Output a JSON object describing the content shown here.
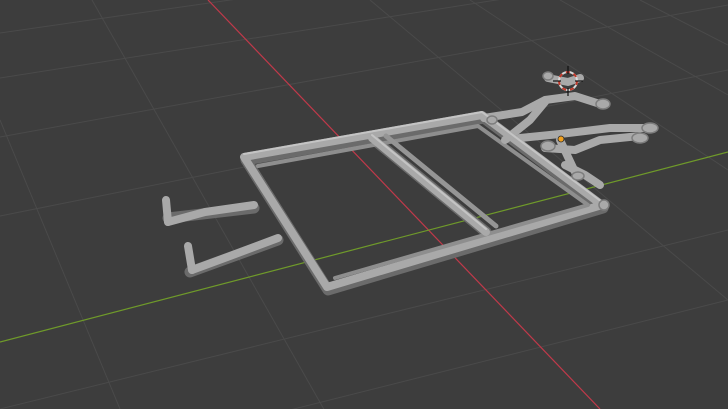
{
  "viewport": {
    "mode": "3d-viewport-solid-shading",
    "background_color": "#3d3d3d",
    "grid_color": "#4a4a4a",
    "x_axis_color": "#c0394a",
    "y_axis_color": "#6f9a2a",
    "mesh_color": "#a9a9a9",
    "mesh_shadow_color": "#6b6b6b",
    "origin_point_color": "#f0a020",
    "cursor_ring_color_a": "#d8d8d8",
    "cursor_ring_color_b": "#c0392b"
  },
  "objects": [
    {
      "name": "tube-frame-chassis",
      "selected": false
    }
  ],
  "cursor": {
    "name": "3d-cursor-icon"
  }
}
